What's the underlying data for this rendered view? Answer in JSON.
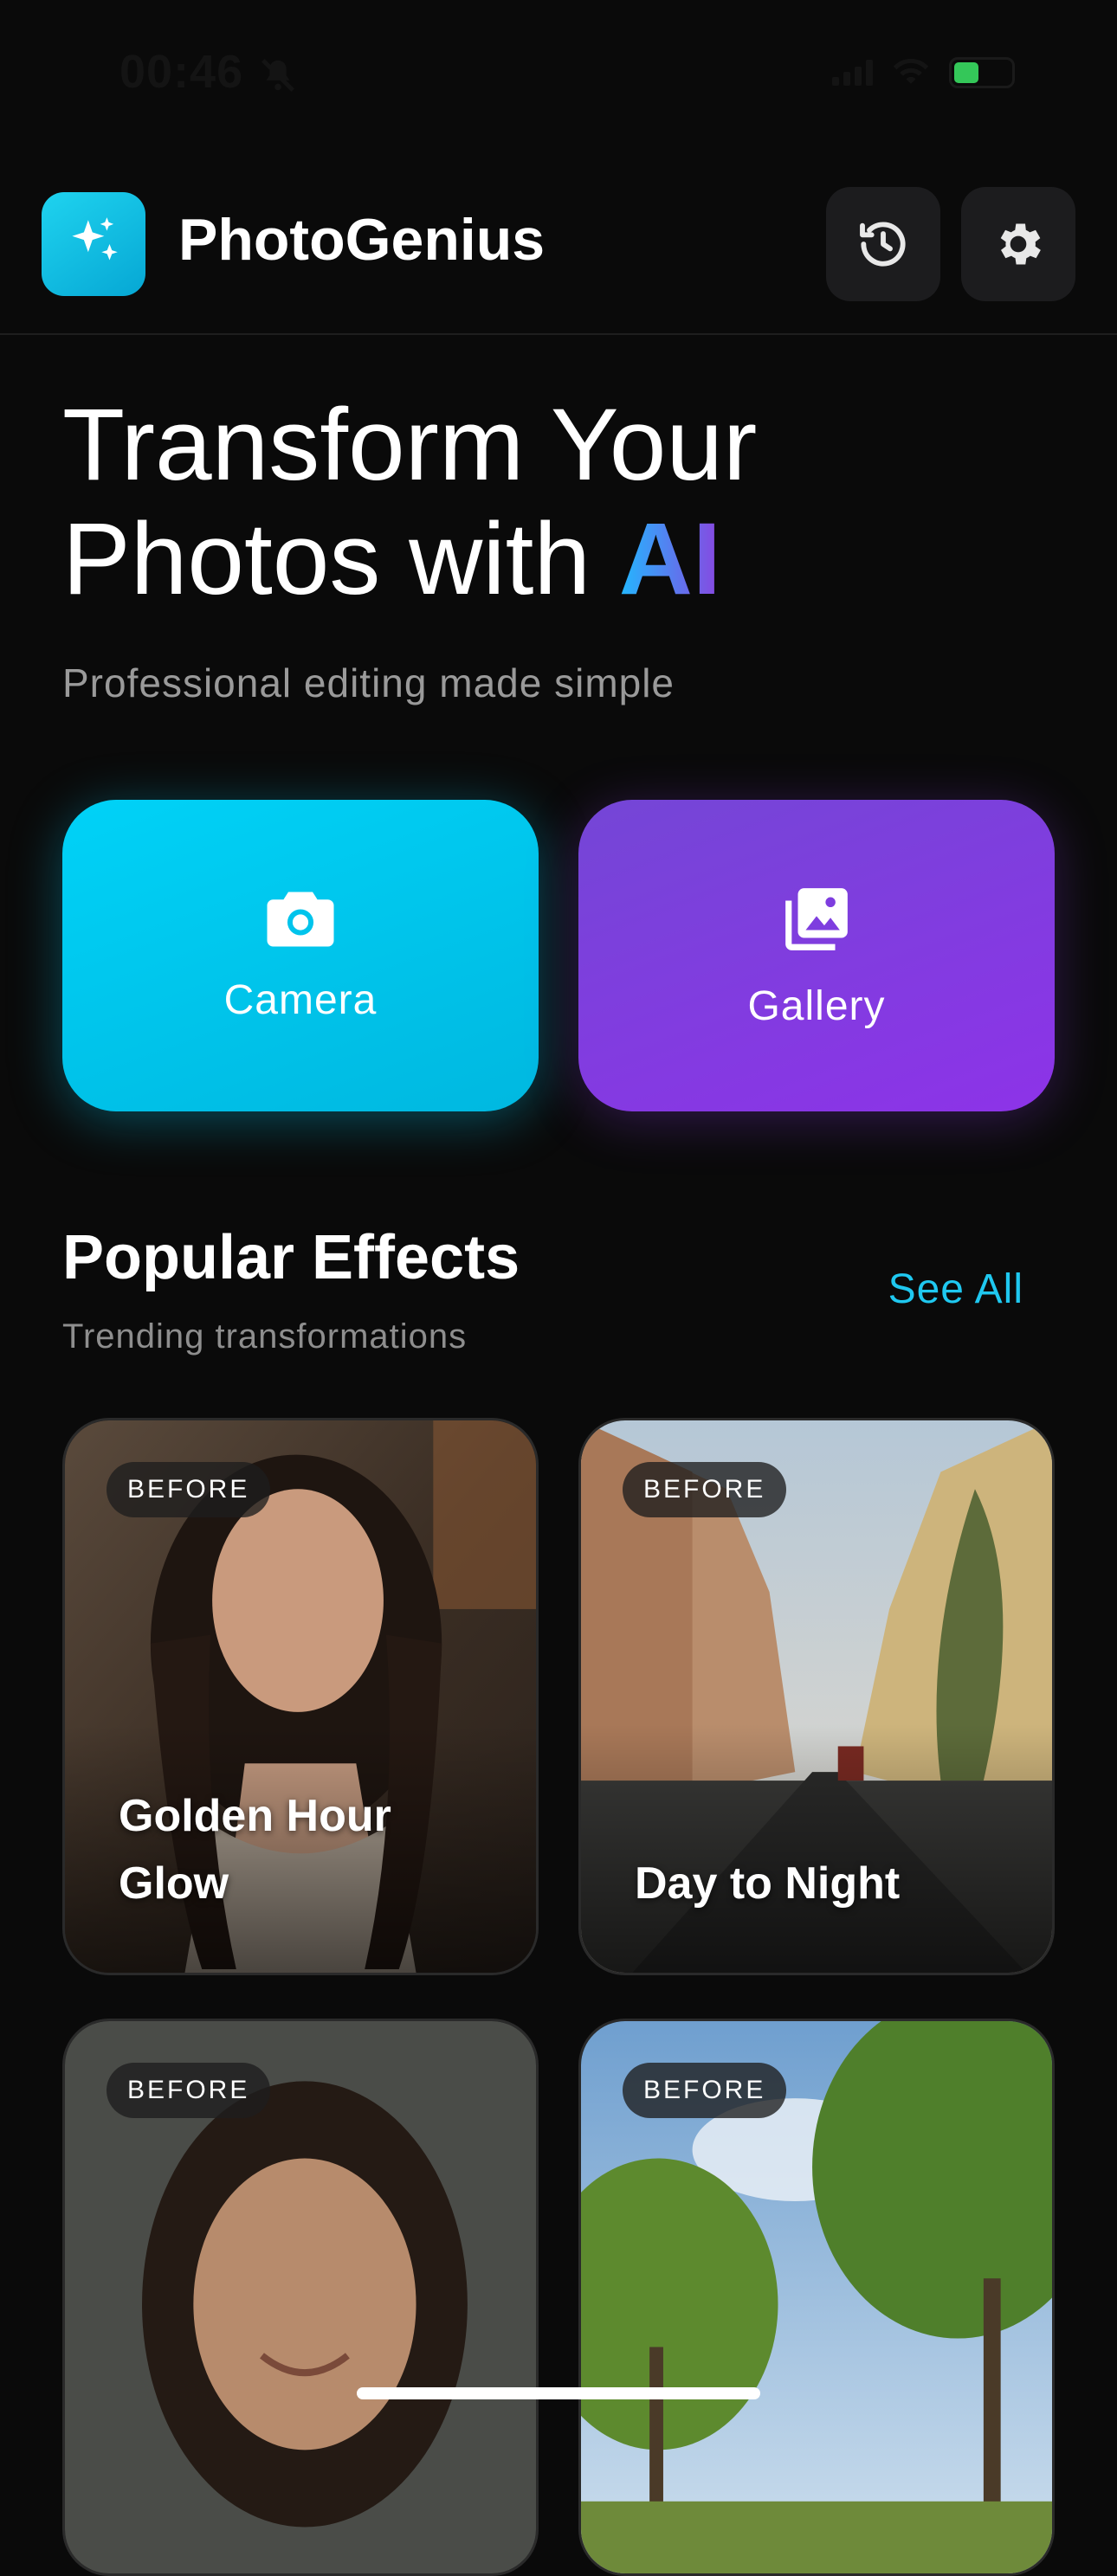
{
  "status_bar": {
    "time": "00:46"
  },
  "header": {
    "app_name": "PhotoGenius",
    "icons": {
      "logo": "sparkles-icon",
      "history": "history-icon",
      "settings": "gear-icon"
    }
  },
  "hero": {
    "line1": "Transform Your",
    "line2_prefix": "Photos with ",
    "line2_accent": "AI",
    "subtitle": "Professional editing made simple"
  },
  "actions": [
    {
      "label": "Camera",
      "icon": "camera-icon",
      "color": "#00c8f0"
    },
    {
      "label": "Gallery",
      "icon": "photo-library-icon",
      "color": "#8a3ce6"
    }
  ],
  "section": {
    "title": "Popular Effects",
    "subtitle": "Trending transformations",
    "see_all": "See All"
  },
  "effects": [
    {
      "badge": "BEFORE",
      "title": "Golden Hour Glow"
    },
    {
      "badge": "BEFORE",
      "title": "Day to Night"
    },
    {
      "badge": "BEFORE",
      "title": ""
    },
    {
      "badge": "BEFORE",
      "title": ""
    }
  ]
}
